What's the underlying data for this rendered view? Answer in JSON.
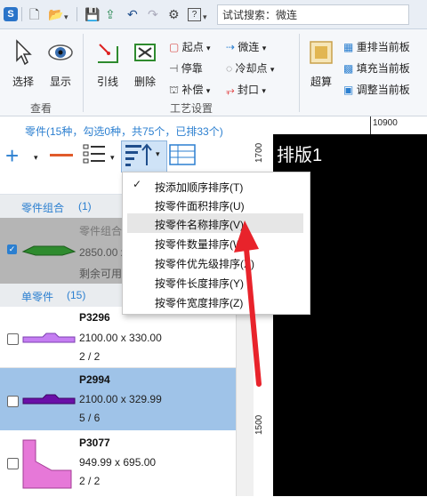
{
  "titlebar": {
    "search_label": "试试搜索：微连",
    "help_icon_label": "?"
  },
  "ribbon": {
    "select_label": "选择",
    "display_label": "显示",
    "view_group": "查看",
    "leadline_label": "引线",
    "delete_label": "删除",
    "start_point_label": "起点",
    "stop_label": "停靠",
    "compensate_label": "补偿",
    "microlink_label": "微连",
    "coolpoint_label": "冷却点",
    "seal_label": "封口",
    "process_group": "工艺设置",
    "super_calc_label": "超算",
    "relayout_label": "重排当前板",
    "fill_label": "填充当前板",
    "adjust_label": "调整当前板"
  },
  "panel": {
    "summary": "零件(15种，勾选0种，共75个，已排33个)"
  },
  "parts": {
    "combo_header": "零件组合",
    "combo_count": "(1)",
    "combo_item_name": "零件组合",
    "combo_item_dim": "2850.00 x",
    "combo_item_remain": "剩余可用",
    "single_header": "单零件",
    "single_count": "(15)",
    "items": [
      {
        "name": "P3296",
        "dim": "2100.00 x 330.00",
        "count": "2 / 2",
        "color": "#c57ef2"
      },
      {
        "name": "P2994",
        "dim": "2100.00 x 329.99",
        "count": "5 / 6",
        "color": "#6a0fa8"
      },
      {
        "name": "P3077",
        "dim": "949.99 x 695.00",
        "count": "2 / 2",
        "color": "#e678d8"
      }
    ]
  },
  "canvas": {
    "sheet_title": "排版1",
    "ruler_top_label": "10900",
    "ruler_left_label_1": "1700",
    "ruler_left_label_2": "1500"
  },
  "sort_menu": {
    "items": [
      "按添加顺序排序(T)",
      "按零件面积排序(U)",
      "按零件名称排序(V)",
      "按零件数量排序(W)",
      "按零件优先级排序(X)",
      "按零件长度排序(Y)",
      "按零件宽度排序(Z)"
    ],
    "checked_index": 0,
    "hover_index": 2
  },
  "colors": {
    "accent": "#2b7fd0",
    "selected_row": "#9fc3e8",
    "annotation_arrow": "#e8232b",
    "combo_part": "#2e8b2e"
  }
}
